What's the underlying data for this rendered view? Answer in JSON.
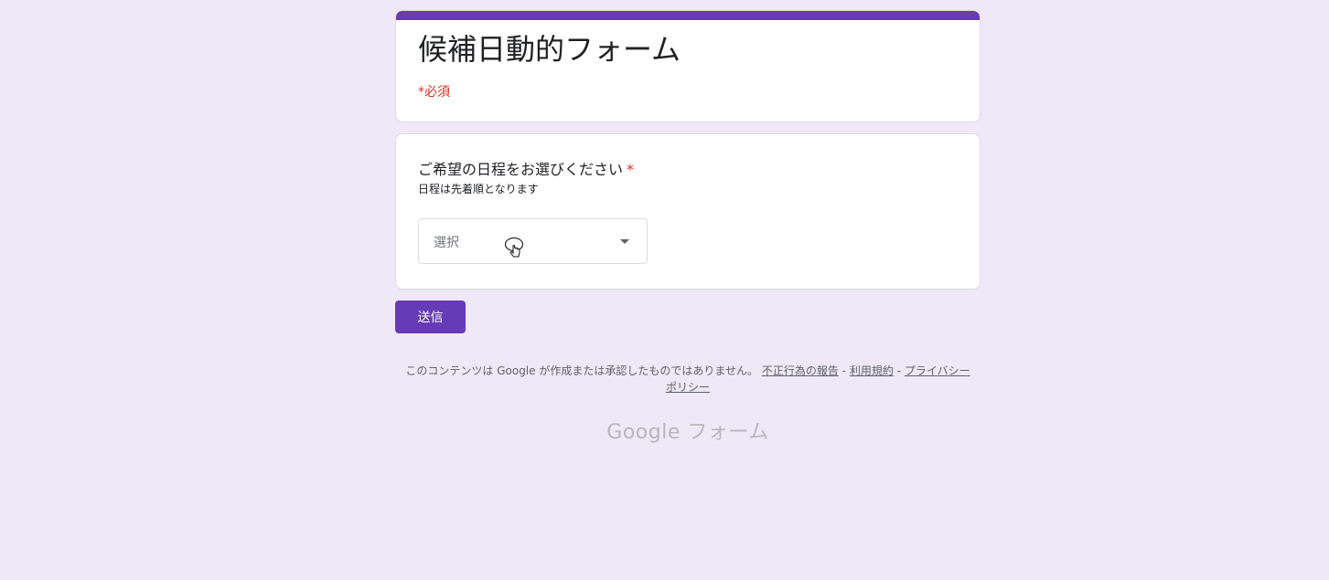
{
  "form": {
    "title": "候補日動的フォーム",
    "required_note": "*必須"
  },
  "question": {
    "title": "ご希望の日程をお選びください",
    "required_mark": "*",
    "description": "日程は先着順となります",
    "dropdown": {
      "value": "選択"
    }
  },
  "submit": {
    "label": "送信"
  },
  "footer": {
    "disclaimer": "このコンテンツは Google が作成または承認したものではありません。",
    "link_report": "不正行為の報告",
    "separator": "-",
    "link_terms": "利用規約",
    "link_privacy": "プライバシー ポリシー"
  },
  "brand": {
    "text": "Google フォーム"
  },
  "colors": {
    "background": "#efe8f6",
    "accent": "#673ab7",
    "required": "#d93025"
  }
}
